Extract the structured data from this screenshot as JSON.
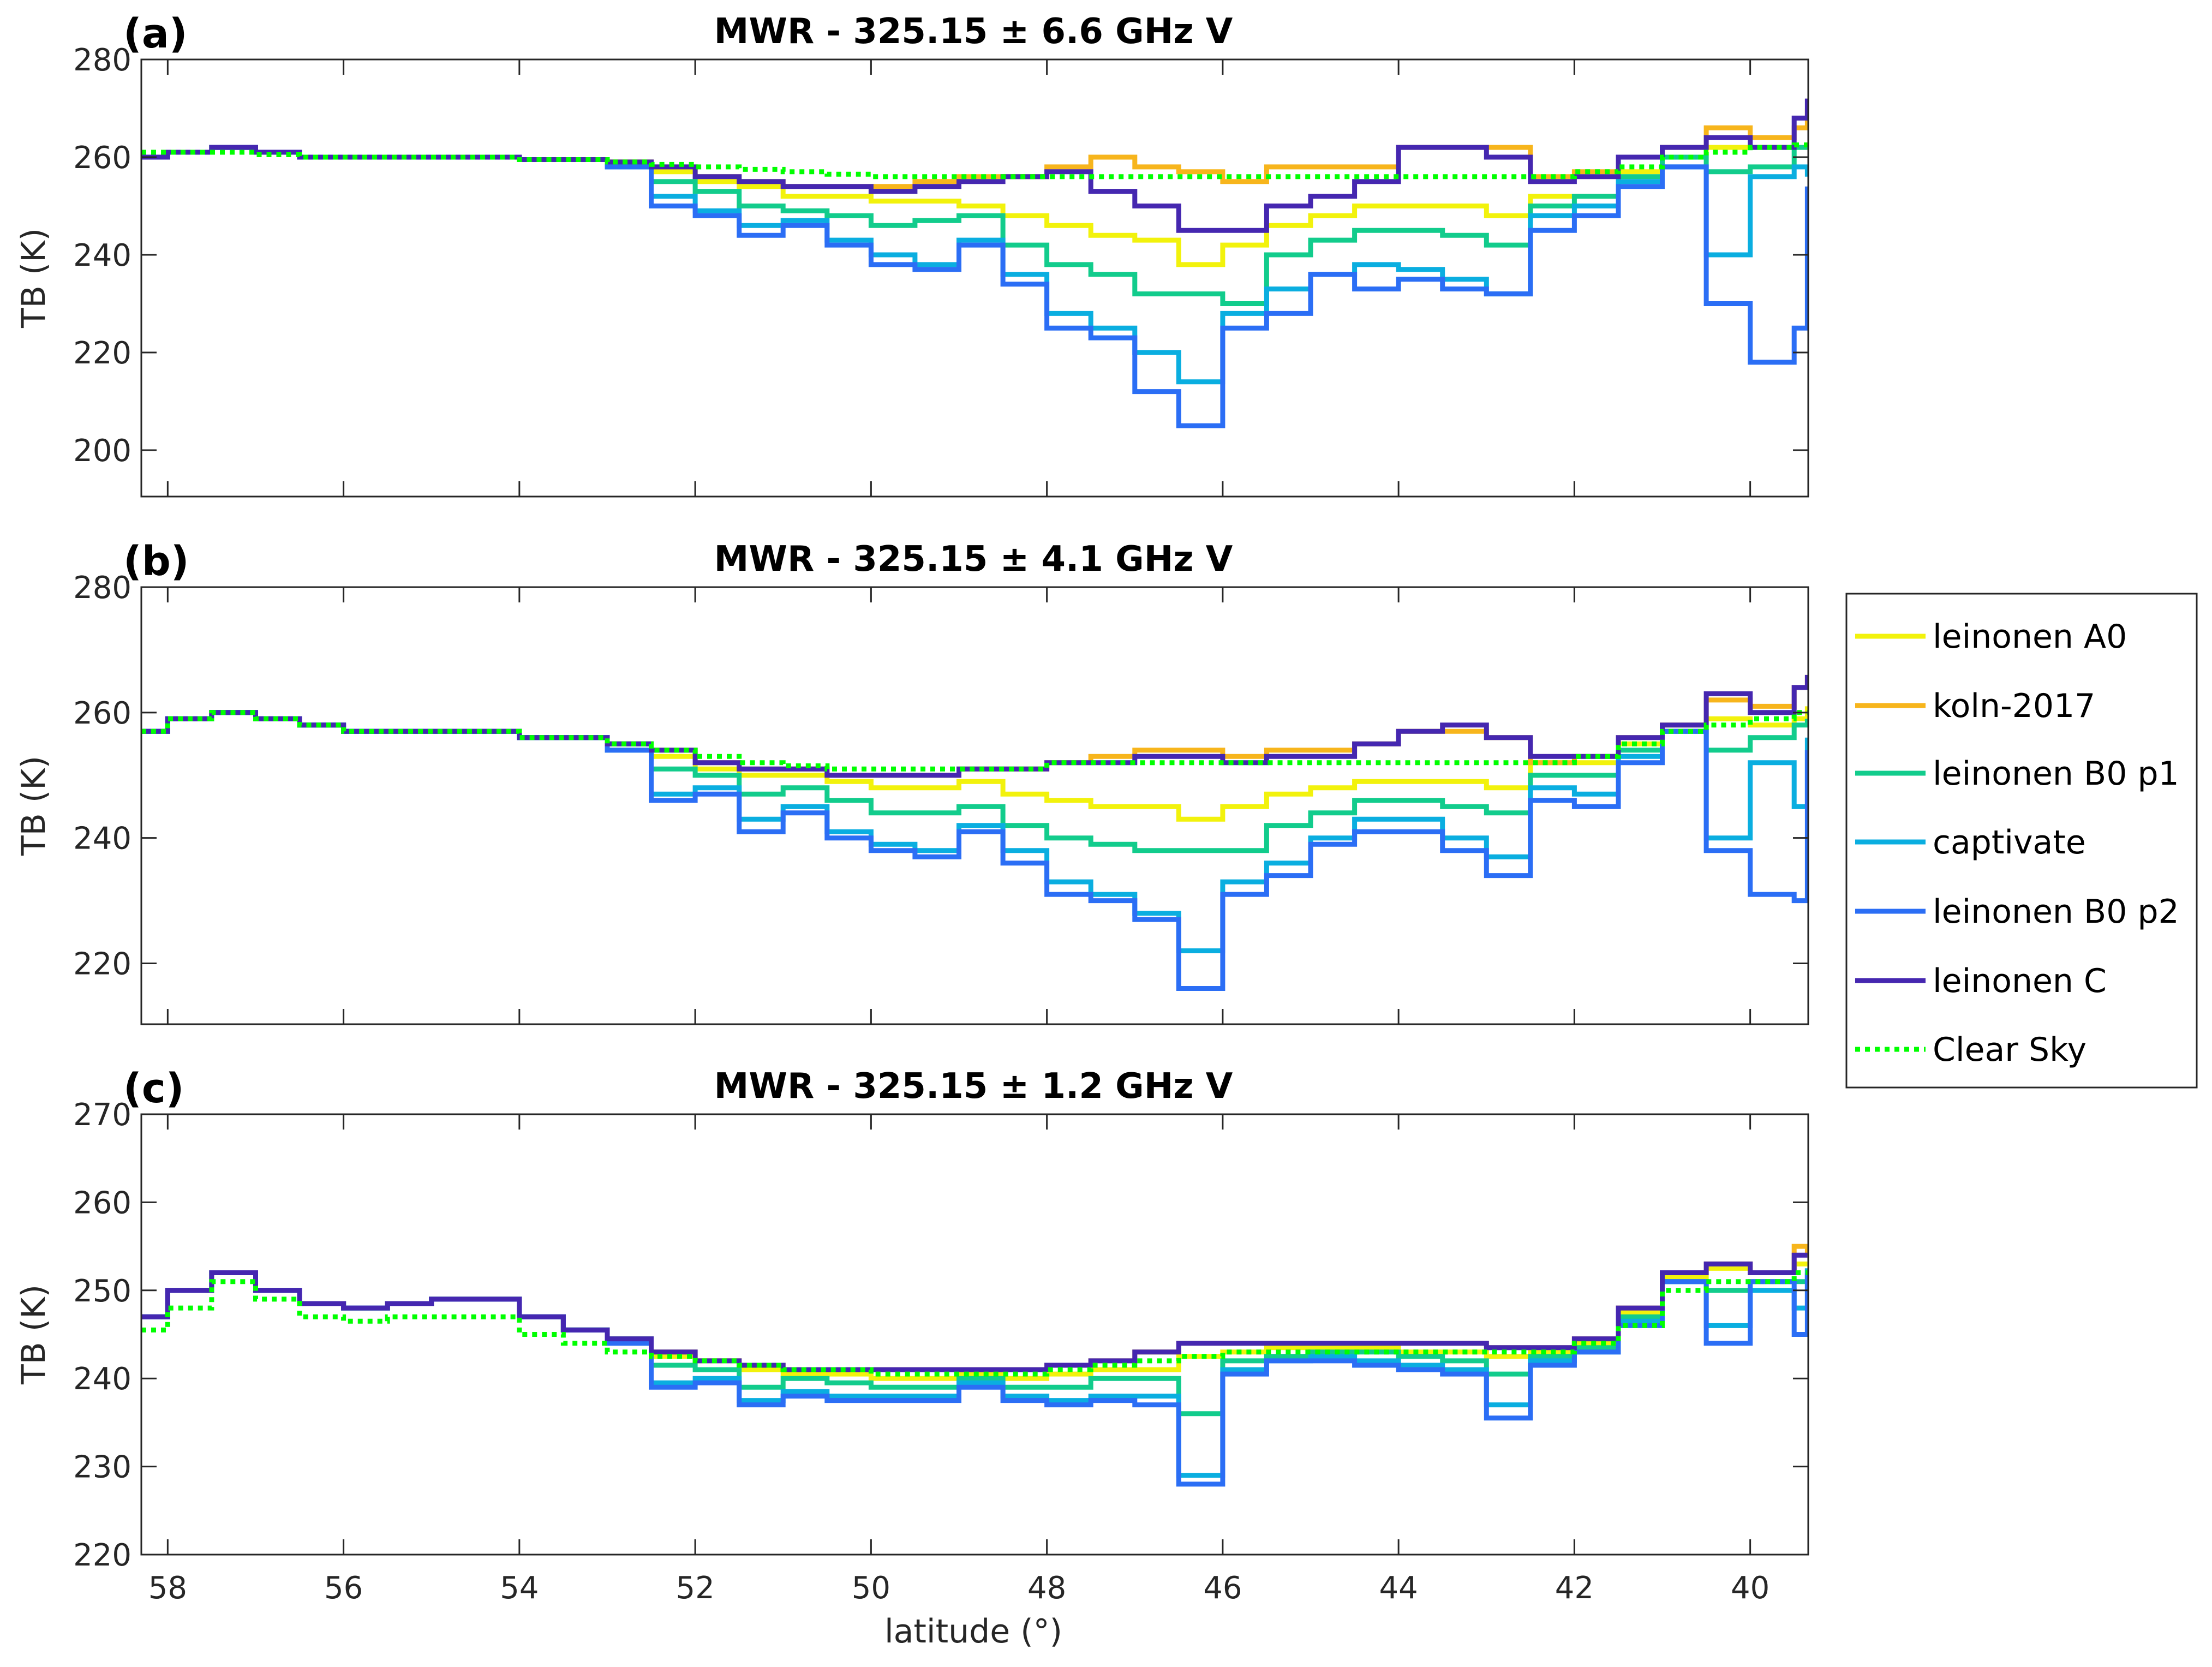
{
  "chart_data": {
    "type": "line",
    "xlabel": "latitude (°)",
    "xlim": [
      39.34,
      58.3
    ],
    "x_reversed": true,
    "xticks": [
      58,
      56,
      54,
      52,
      50,
      48,
      46,
      44,
      42,
      40
    ],
    "grid": false,
    "legend": {
      "placement": "right-middle",
      "entries": [
        {
          "key": "A0",
          "name": "leinonen A0",
          "color": "#f2f20c",
          "style": "solid"
        },
        {
          "key": "koln",
          "name": "koln-2017",
          "color": "#f7b51c",
          "style": "solid"
        },
        {
          "key": "B0p1",
          "name": "leinonen B0 p1",
          "color": "#12cc8c",
          "style": "solid"
        },
        {
          "key": "captivate",
          "name": "captivate",
          "color": "#0aaee0",
          "style": "solid"
        },
        {
          "key": "B0p2",
          "name": "leinonen B0 p2",
          "color": "#2b6ef5",
          "style": "solid"
        },
        {
          "key": "C",
          "name": "leinonen C",
          "color": "#4527b0",
          "style": "solid"
        },
        {
          "key": "clear",
          "name": "Clear Sky",
          "color": "#00ff00",
          "style": "dotted"
        }
      ]
    },
    "x": [
      58.3,
      58,
      57.5,
      57,
      56.5,
      56,
      55.5,
      55,
      54.5,
      54,
      53.5,
      53,
      52.5,
      52,
      51.5,
      51,
      50.5,
      50,
      49.5,
      49,
      48.5,
      48,
      47.5,
      47,
      46.5,
      46,
      45.5,
      45,
      44.5,
      44,
      43.5,
      43,
      42.5,
      42,
      41.5,
      41,
      40.5,
      40,
      39.5,
      39.35
    ],
    "panels": [
      {
        "label": "(a)",
        "title": "MWR - 325.15 ± 6.6 GHz V",
        "ylabel": "TB (K)",
        "ylim": [
          190.5,
          280
        ],
        "yticks": [
          200,
          220,
          240,
          260,
          280
        ],
        "series": {
          "A0": [
            260,
            261,
            262,
            261,
            260,
            260,
            260,
            260,
            260,
            259.5,
            259.5,
            259,
            257,
            255,
            254,
            252,
            252,
            251,
            251,
            250,
            248,
            246,
            244,
            243,
            238,
            242,
            246,
            248,
            250,
            250,
            250,
            248,
            252,
            252,
            257,
            260,
            262,
            262,
            262,
            263
          ],
          "koln": [
            260,
            261,
            262,
            261,
            260,
            260,
            260,
            260,
            260,
            259.5,
            259.5,
            259,
            258,
            256,
            255,
            254,
            254,
            254,
            255,
            256,
            256,
            258,
            260,
            258,
            257,
            255,
            258,
            258,
            258,
            262,
            262,
            262,
            256,
            257,
            260,
            262,
            266,
            264,
            266,
            270
          ],
          "B0p1": [
            260,
            261,
            262,
            261,
            260,
            260,
            260,
            260,
            260,
            259.5,
            259.5,
            258.5,
            255,
            253,
            250,
            249,
            248,
            246,
            247,
            248,
            242,
            238,
            236,
            232,
            232,
            230,
            240,
            243,
            245,
            245,
            244,
            242,
            250,
            252,
            256,
            260,
            257,
            258,
            262,
            262
          ],
          "captivate": [
            260,
            261,
            262,
            261,
            260,
            260,
            260,
            260,
            260,
            259.5,
            259.5,
            258,
            252,
            249,
            246,
            247,
            243,
            240,
            238,
            243,
            236,
            228,
            225,
            220,
            214,
            228,
            233,
            236,
            238,
            237,
            235,
            232,
            248,
            250,
            255,
            258,
            240,
            256,
            258,
            256
          ],
          "B0p2": [
            260,
            261,
            262,
            261,
            260,
            260,
            260,
            260,
            260,
            259.5,
            259.5,
            258,
            250,
            248,
            244,
            246,
            242,
            238,
            237,
            242,
            234,
            225,
            223,
            212,
            205,
            225,
            228,
            236,
            233,
            235,
            233,
            232,
            245,
            248,
            254,
            258,
            230,
            218,
            225,
            254
          ],
          "C": [
            260,
            261,
            262,
            261,
            260,
            260,
            260,
            260,
            260,
            259.5,
            259.5,
            259,
            258,
            256,
            255,
            254,
            254,
            253,
            254,
            255,
            256,
            257,
            253,
            250,
            245,
            245,
            250,
            252,
            255,
            262,
            262,
            260,
            255,
            256,
            260,
            262,
            264,
            262,
            268,
            272
          ],
          "clear": [
            261,
            261,
            261,
            260.5,
            260,
            260,
            260,
            260,
            260,
            259.5,
            259.5,
            259,
            258.5,
            258,
            257.5,
            257,
            256.5,
            256,
            256,
            256,
            256,
            256,
            256,
            256,
            256,
            256,
            256,
            256,
            256,
            256,
            256,
            256,
            256,
            257,
            258,
            260,
            261,
            262,
            262.5,
            262.5
          ]
        }
      },
      {
        "label": "(b)",
        "title": "MWR - 325.15 ± 4.1 GHz V",
        "ylabel": "TB (K)",
        "ylim": [
          210.3,
          280
        ],
        "yticks": [
          220,
          240,
          260,
          280
        ],
        "series": {
          "A0": [
            257,
            259,
            260,
            259,
            258,
            257,
            257,
            257,
            257,
            256,
            256,
            255,
            253,
            251,
            250,
            250,
            249,
            248,
            248,
            249,
            247,
            246,
            245,
            245,
            243,
            245,
            247,
            248,
            249,
            249,
            249,
            248,
            252,
            252,
            255,
            257,
            259,
            258,
            259,
            261
          ],
          "koln": [
            257,
            259,
            260,
            259,
            258,
            257,
            257,
            257,
            257,
            256,
            256,
            255,
            254,
            252,
            251,
            251,
            250,
            250,
            250,
            251,
            251,
            252,
            253,
            254,
            254,
            253,
            254,
            254,
            255,
            257,
            257,
            256,
            252,
            253,
            256,
            258,
            262,
            261,
            264,
            266
          ],
          "B0p1": [
            257,
            259,
            260,
            259,
            258,
            257,
            257,
            257,
            257,
            256,
            256,
            255,
            251,
            250,
            247,
            248,
            246,
            244,
            244,
            245,
            242,
            240,
            239,
            238,
            238,
            238,
            242,
            244,
            246,
            246,
            245,
            244,
            250,
            250,
            254,
            257,
            254,
            256,
            258,
            259
          ],
          "captivate": [
            257,
            259,
            260,
            259,
            258,
            257,
            257,
            257,
            257,
            256,
            256,
            254,
            247,
            248,
            243,
            245,
            241,
            239,
            238,
            242,
            238,
            233,
            231,
            228,
            222,
            233,
            236,
            240,
            243,
            243,
            240,
            237,
            248,
            247,
            253,
            257,
            240,
            252,
            245,
            256
          ],
          "B0p2": [
            257,
            259,
            260,
            259,
            258,
            257,
            257,
            257,
            257,
            256,
            256,
            254,
            246,
            247,
            241,
            244,
            240,
            238,
            237,
            241,
            236,
            231,
            230,
            227,
            216,
            231,
            234,
            239,
            241,
            241,
            238,
            234,
            246,
            245,
            252,
            257,
            238,
            231,
            230,
            254
          ],
          "C": [
            257,
            259,
            260,
            259,
            258,
            257,
            257,
            257,
            257,
            256,
            256,
            255,
            254,
            252,
            251,
            251,
            250,
            250,
            250,
            251,
            251,
            252,
            252,
            253,
            253,
            252,
            253,
            253,
            255,
            257,
            258,
            256,
            253,
            253,
            256,
            258,
            263,
            260,
            264,
            266
          ],
          "clear": [
            257,
            259,
            260,
            259,
            258,
            257,
            257,
            257,
            257,
            256,
            256,
            255,
            254,
            253,
            252,
            251.5,
            251,
            251,
            251,
            251,
            251,
            252,
            252,
            252,
            252,
            252,
            252,
            252,
            252,
            252,
            252,
            252,
            252,
            253,
            255,
            257,
            258,
            259,
            260,
            260
          ]
        }
      },
      {
        "label": "(c)",
        "title": "MWR - 325.15 ± 1.2 GHz V",
        "ylabel": "TB (K)",
        "ylim": [
          220,
          270
        ],
        "yticks": [
          220,
          230,
          240,
          250,
          260,
          270
        ],
        "series": {
          "A0": [
            247,
            250,
            252,
            250,
            248.5,
            248,
            248.5,
            249,
            249,
            247,
            245.5,
            244.5,
            242.5,
            242,
            241,
            240.5,
            240.5,
            240,
            240,
            240.5,
            240,
            240.5,
            241,
            241,
            242.5,
            243,
            243.5,
            243.5,
            243.5,
            243,
            243,
            242.5,
            243,
            244,
            247.5,
            251.5,
            252.5,
            252,
            253,
            253
          ],
          "koln": [
            247,
            250,
            252,
            250,
            248.5,
            248,
            248.5,
            249,
            249,
            247,
            245.5,
            244.5,
            243,
            242,
            241.5,
            241,
            241,
            241,
            241,
            241,
            241,
            241.5,
            242,
            243,
            244,
            244,
            244,
            244,
            244,
            244,
            244,
            243.5,
            243.5,
            244.5,
            248,
            252,
            253,
            252,
            255,
            254
          ],
          "B0p1": [
            247,
            250,
            252,
            250,
            248.5,
            248,
            248.5,
            249,
            249,
            247,
            245.5,
            244.5,
            241.5,
            241,
            239,
            240,
            239.5,
            239,
            239,
            240,
            239,
            239,
            240,
            240,
            236,
            242,
            242.5,
            243,
            243,
            242.5,
            242,
            240.5,
            242.5,
            243.5,
            247,
            251,
            250,
            251,
            251,
            252.5
          ],
          "captivate": [
            247,
            250,
            252,
            250,
            248.5,
            248,
            248.5,
            249,
            249,
            247,
            245.5,
            244,
            239.5,
            240,
            237.5,
            238.5,
            238,
            238,
            238,
            239.5,
            238,
            237.5,
            238,
            238,
            229,
            241,
            242,
            242.5,
            242,
            241.5,
            241,
            237,
            242,
            243,
            246.5,
            251,
            246,
            250,
            248,
            252.5
          ],
          "B0p2": [
            247,
            250,
            252,
            250,
            248.5,
            248,
            248.5,
            249,
            249,
            247,
            245.5,
            244,
            239,
            239.5,
            237,
            238,
            237.5,
            237.5,
            237.5,
            239,
            237.5,
            237,
            237.5,
            237,
            228,
            240.5,
            242,
            242,
            241.5,
            241,
            240.5,
            235.5,
            241.5,
            243,
            246,
            251,
            244,
            251,
            245,
            252
          ],
          "C": [
            247,
            250,
            252,
            250,
            248.5,
            248,
            248.5,
            249,
            249,
            247,
            245.5,
            244.5,
            243,
            242,
            241.5,
            241,
            241,
            241,
            241,
            241,
            241,
            241.5,
            242,
            243,
            244,
            244,
            244,
            244,
            244,
            244,
            244,
            243.5,
            243.5,
            244.5,
            248,
            252,
            253,
            252,
            254,
            254
          ],
          "clear": [
            245.5,
            248,
            251,
            249,
            247,
            246.5,
            247,
            247,
            247,
            245,
            244,
            243,
            242.5,
            242,
            241.5,
            241,
            241,
            240.5,
            240.5,
            240.5,
            240.5,
            241,
            241.5,
            242,
            242.5,
            243,
            243,
            243,
            243,
            243,
            243,
            243,
            243,
            244,
            246,
            250,
            251,
            251,
            252,
            252
          ]
        }
      }
    ]
  }
}
